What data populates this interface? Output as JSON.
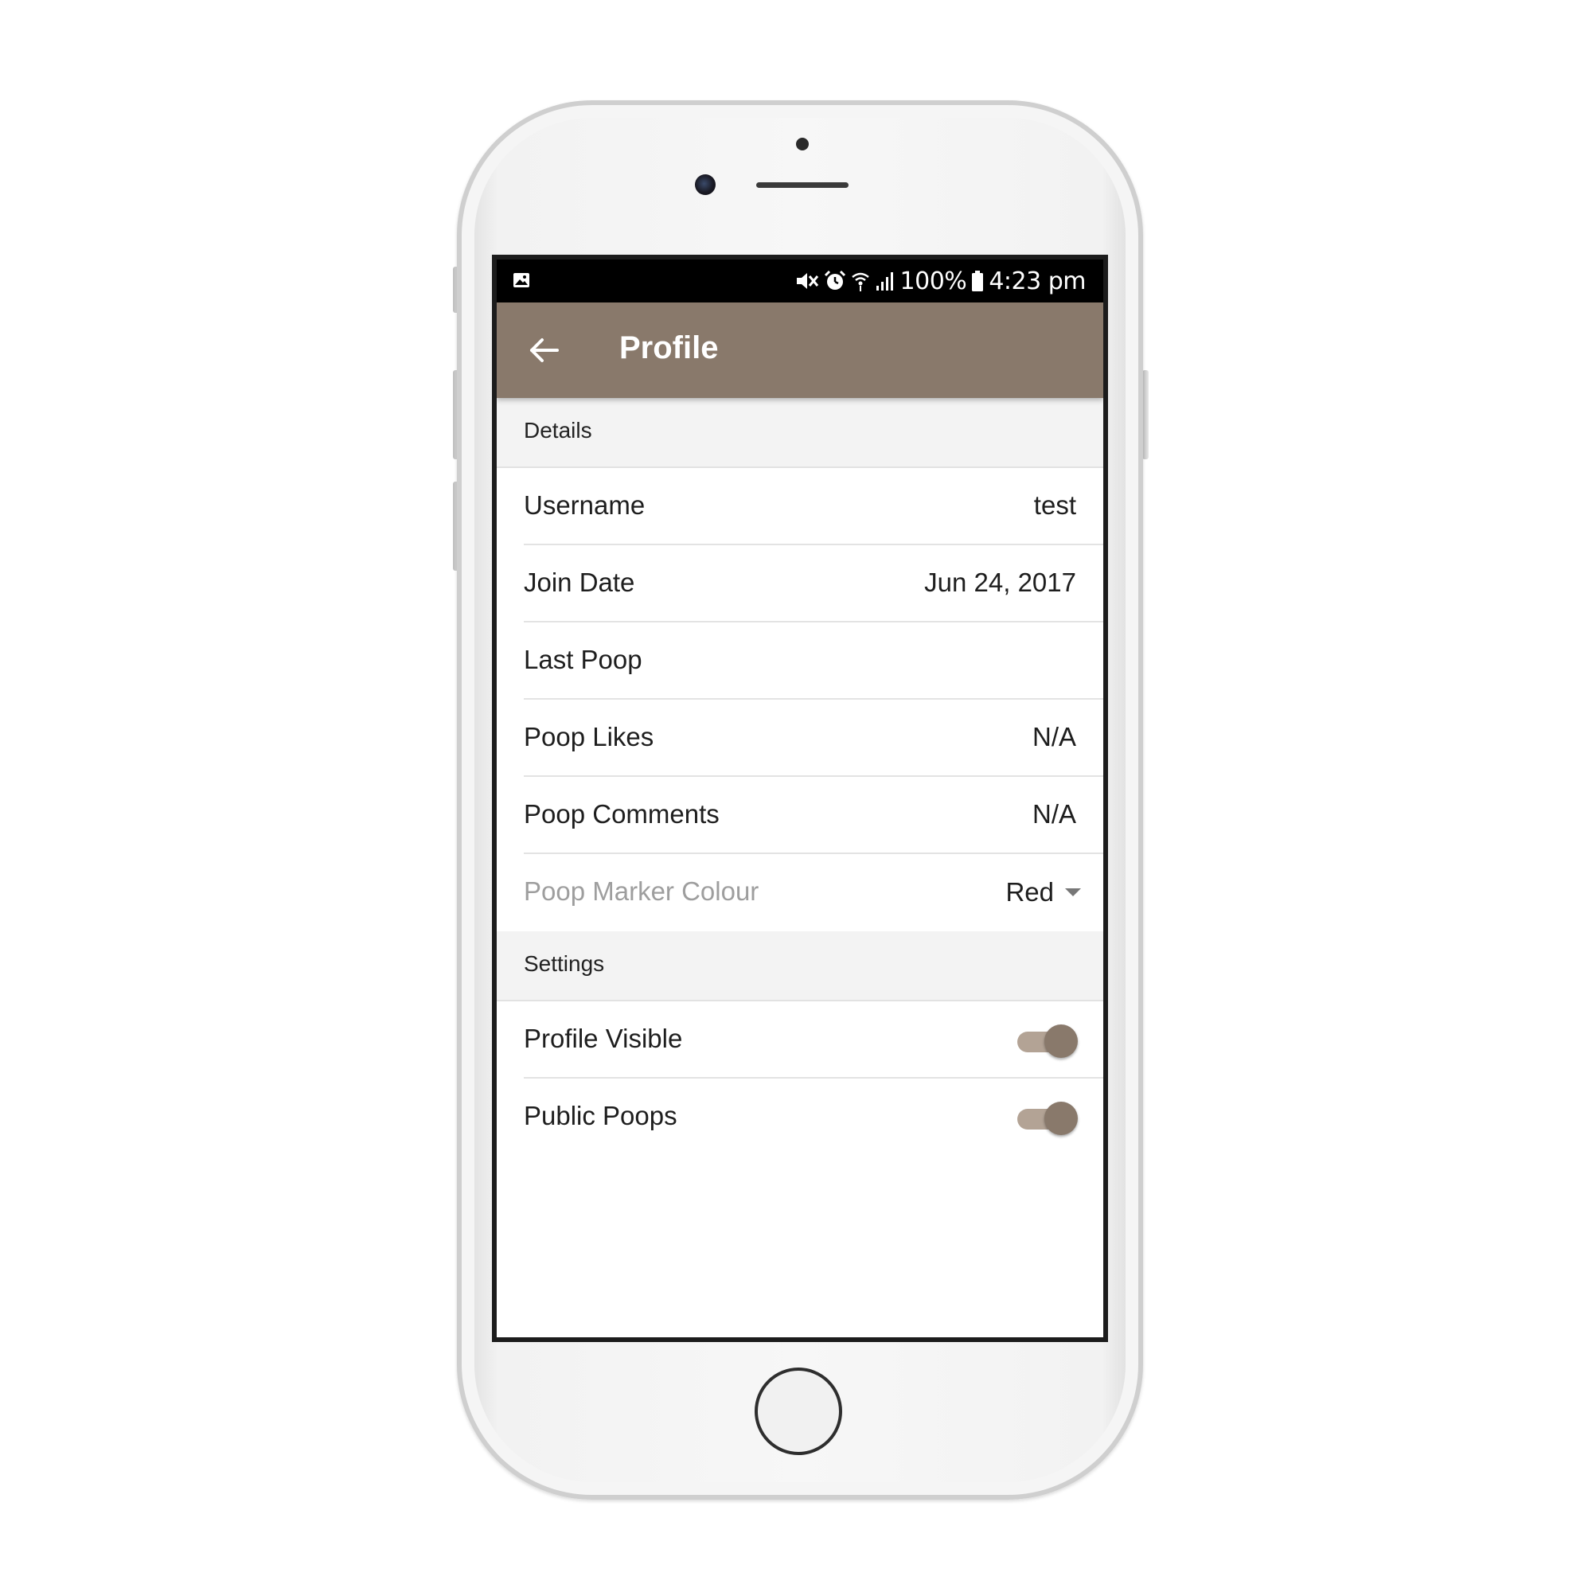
{
  "status_bar": {
    "battery": "100%",
    "time": "4:23 pm",
    "icons": [
      "image-icon",
      "mute-icon",
      "alarm-icon",
      "wifi-icon",
      "signal-icon",
      "battery-icon"
    ]
  },
  "app_bar": {
    "title": "Profile",
    "back_icon": "arrow-back-icon",
    "color": "#89796b"
  },
  "details": {
    "header": "Details",
    "username": {
      "label": "Username",
      "value": "test"
    },
    "join_date": {
      "label": "Join Date",
      "value": "Jun 24, 2017"
    },
    "last_poop": {
      "label": "Last Poop",
      "value": ""
    },
    "poop_likes": {
      "label": "Poop Likes",
      "value": "N/A"
    },
    "poop_comments": {
      "label": "Poop Comments",
      "value": "N/A"
    },
    "marker_colour": {
      "label": "Poop Marker Colour",
      "selected": "Red"
    }
  },
  "settings": {
    "header": "Settings",
    "profile_visible": {
      "label": "Profile Visible",
      "on": true
    },
    "public_poops": {
      "label": "Public Poops",
      "on": true
    }
  },
  "colors": {
    "accent": "#89796b",
    "toggle_track": "#b3a395"
  }
}
